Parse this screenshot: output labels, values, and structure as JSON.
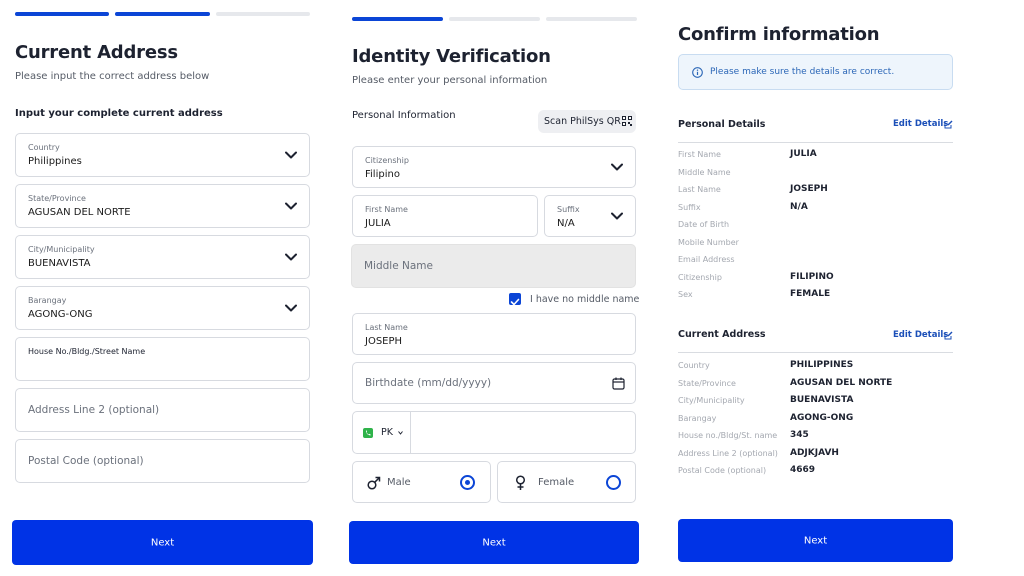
{
  "address": {
    "title": "Current Address",
    "subtitle": "Please input the correct address below",
    "section": "Input your complete current address",
    "fields": [
      {
        "label": "Country",
        "value": "Philippines"
      },
      {
        "label": "State/Province",
        "value": "AGUSAN DEL NORTE"
      },
      {
        "label": "City/Municipality",
        "value": "BUENAVISTA"
      },
      {
        "label": "Barangay",
        "value": "AGONG-ONG"
      },
      {
        "label": "House No./Bldg./Street Name",
        "value": ""
      }
    ],
    "address2_placeholder": "Address Line 2 (optional)",
    "postal_placeholder": "Postal Code (optional)",
    "next_label": "Next"
  },
  "identity": {
    "title": "Identity Verification",
    "subtitle": "Please enter your personal information",
    "section": "Personal Information",
    "scan_label": "Scan PhilSys QR",
    "citizenship": {
      "label": "Citizenship",
      "value": "Filipino"
    },
    "first_name": {
      "label": "First Name",
      "value": "JULIA"
    },
    "suffix": {
      "label": "Suffix",
      "value": "N/A"
    },
    "middle_placeholder": "Middle Name",
    "no_middle_label": "I have no middle name",
    "last_name": {
      "label": "Last Name",
      "value": "JOSEPH"
    },
    "birthdate_placeholder": "Birthdate (mm/dd/yyyy)",
    "country_code": "PK",
    "male_label": "Male",
    "female_label": "Female",
    "next_label": "Next"
  },
  "confirm": {
    "title": "Confirm information",
    "info_text": "Please make sure the details are correct.",
    "personal_heading": "Personal Details",
    "address_heading": "Current Address",
    "edit_label": "Edit Details",
    "personal_rows": [
      {
        "label": "First Name",
        "value": "JULIA"
      },
      {
        "label": "Middle Name",
        "value": ""
      },
      {
        "label": "Last Name",
        "value": "JOSEPH"
      },
      {
        "label": "Suffix",
        "value": "N/A"
      },
      {
        "label": "Date of Birth",
        "value": ""
      },
      {
        "label": "Mobile Number",
        "value": ""
      },
      {
        "label": "Email Address",
        "value": ""
      },
      {
        "label": "Citizenship",
        "value": "FILIPINO"
      },
      {
        "label": "Sex",
        "value": "FEMALE"
      }
    ],
    "address_rows": [
      {
        "label": "Country",
        "value": "PHILIPPINES"
      },
      {
        "label": "State/Province",
        "value": "AGUSAN DEL NORTE"
      },
      {
        "label": "City/Municipality",
        "value": "BUENAVISTA"
      },
      {
        "label": "Barangay",
        "value": "AGONG-ONG"
      },
      {
        "label": "House no./Bldg/St. name",
        "value": "345"
      },
      {
        "label": "Address Line 2 (optional)",
        "value": "ADJKJAVH"
      },
      {
        "label": "Postal Code (optional)",
        "value": "4669"
      }
    ],
    "next_label": "Next"
  },
  "colors": {
    "primary": "#0033e6",
    "progress_active": "#0b45d6",
    "info_bg": "#eef5fc"
  },
  "icons": [
    "chevron-down-icon",
    "qr-code-icon",
    "calendar-icon",
    "phone-icon",
    "male-icon",
    "female-icon",
    "info-icon",
    "edit-icon",
    "checkmark-icon"
  ]
}
